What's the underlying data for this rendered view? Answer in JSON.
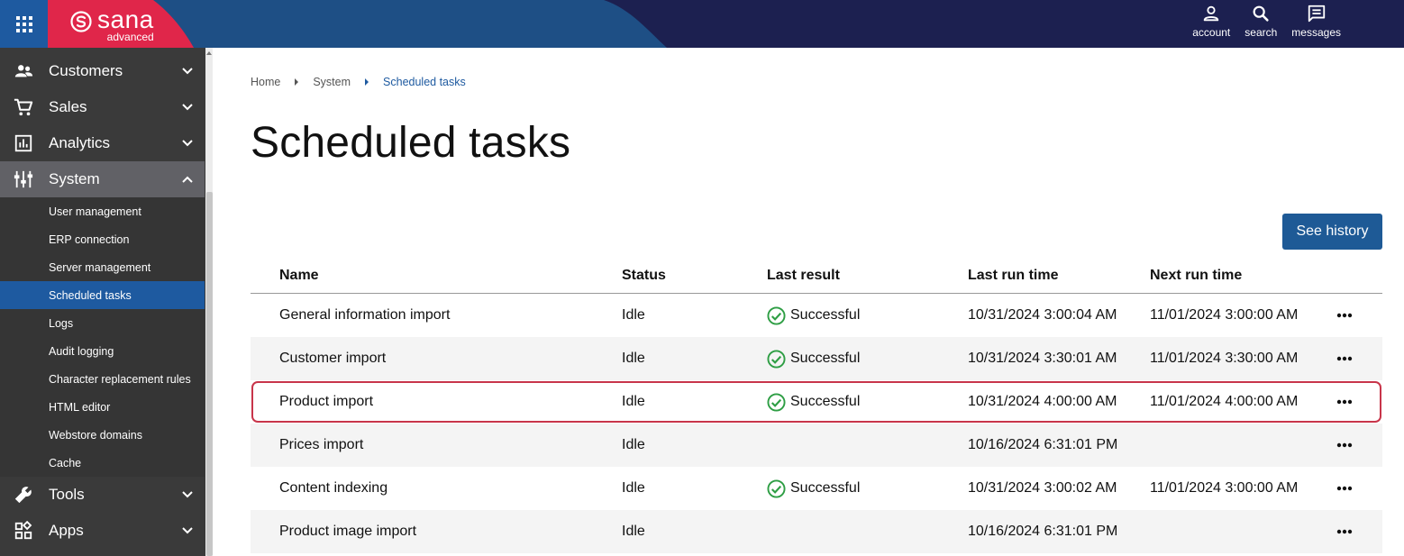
{
  "header": {
    "logo_name": "sana",
    "logo_sub": "advanced",
    "actions": [
      {
        "label": "account",
        "icon": "person-icon"
      },
      {
        "label": "search",
        "icon": "search-icon"
      },
      {
        "label": "messages",
        "icon": "messages-icon"
      }
    ]
  },
  "sidebar": {
    "items": [
      {
        "label": "Customers",
        "icon": "people-icon"
      },
      {
        "label": "Sales",
        "icon": "cart-icon"
      },
      {
        "label": "Analytics",
        "icon": "chart-icon"
      },
      {
        "label": "System",
        "icon": "sliders-icon"
      },
      {
        "label": "Tools",
        "icon": "wrench-icon"
      },
      {
        "label": "Apps",
        "icon": "apps-icon"
      }
    ],
    "system_sub": [
      "User management",
      "ERP connection",
      "Server management",
      "Scheduled tasks",
      "Logs",
      "Audit logging",
      "Character replacement rules",
      "HTML editor",
      "Webstore domains",
      "Cache"
    ]
  },
  "breadcrumb": [
    "Home",
    "System",
    "Scheduled tasks"
  ],
  "page_title": "Scheduled tasks",
  "see_history_label": "See history",
  "table": {
    "columns": [
      "Name",
      "Status",
      "Last result",
      "Last run time",
      "Next run time"
    ],
    "rows": [
      {
        "name": "General information import",
        "status": "Idle",
        "result": "Successful",
        "last": "10/31/2024 3:00:04 AM",
        "next": "11/01/2024 3:00:00 AM"
      },
      {
        "name": "Customer import",
        "status": "Idle",
        "result": "Successful",
        "last": "10/31/2024 3:30:01 AM",
        "next": "11/01/2024 3:30:00 AM"
      },
      {
        "name": "Product import",
        "status": "Idle",
        "result": "Successful",
        "last": "10/31/2024 4:00:00 AM",
        "next": "11/01/2024 4:00:00 AM"
      },
      {
        "name": "Prices import",
        "status": "Idle",
        "result": "",
        "last": "10/16/2024 6:31:01 PM",
        "next": ""
      },
      {
        "name": "Content indexing",
        "status": "Idle",
        "result": "Successful",
        "last": "10/31/2024 3:00:02 AM",
        "next": "11/01/2024 3:00:00 AM"
      },
      {
        "name": "Product image import",
        "status": "Idle",
        "result": "",
        "last": "10/16/2024 6:31:01 PM",
        "next": ""
      }
    ]
  },
  "colors": {
    "header_bg": "#1c2050",
    "brand_red": "#e0264a",
    "accent_blue": "#1e5aa0",
    "success_green": "#2e9e44",
    "highlight_border": "#c8354a"
  }
}
